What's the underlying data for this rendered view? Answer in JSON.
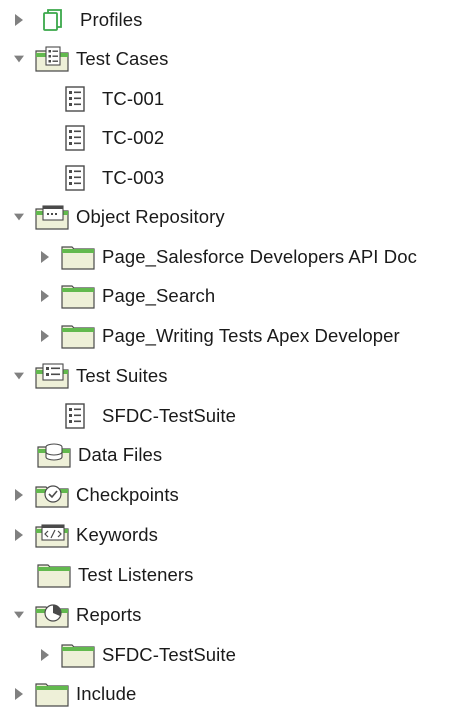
{
  "tree": {
    "items": [
      {
        "label": "Profiles",
        "expanded": false,
        "has_arrow": true,
        "icon": "profiles-icon"
      },
      {
        "label": "Test Cases",
        "expanded": true,
        "has_arrow": true,
        "icon": "test-cases-folder-icon"
      },
      {
        "label": "TC-001",
        "has_arrow": false,
        "icon": "test-case-icon"
      },
      {
        "label": "TC-002",
        "has_arrow": false,
        "icon": "test-case-icon"
      },
      {
        "label": "TC-003",
        "has_arrow": false,
        "icon": "test-case-icon"
      },
      {
        "label": "Object Repository",
        "expanded": true,
        "has_arrow": true,
        "icon": "object-repository-folder-icon"
      },
      {
        "label": "Page_Salesforce Developers  API Doc",
        "expanded": false,
        "has_arrow": true,
        "icon": "folder-icon"
      },
      {
        "label": "Page_Search",
        "expanded": false,
        "has_arrow": true,
        "icon": "folder-icon"
      },
      {
        "label": "Page_Writing Tests  Apex Developer",
        "expanded": false,
        "has_arrow": true,
        "icon": "folder-icon"
      },
      {
        "label": "Test Suites",
        "expanded": true,
        "has_arrow": true,
        "icon": "test-suites-folder-icon"
      },
      {
        "label": "SFDC-TestSuite",
        "has_arrow": false,
        "icon": "test-suite-icon"
      },
      {
        "label": "Data Files",
        "has_arrow": false,
        "icon": "data-files-folder-icon"
      },
      {
        "label": "Checkpoints",
        "expanded": false,
        "has_arrow": true,
        "icon": "checkpoints-folder-icon"
      },
      {
        "label": "Keywords",
        "expanded": false,
        "has_arrow": true,
        "icon": "keywords-folder-icon"
      },
      {
        "label": "Test Listeners",
        "has_arrow": false,
        "icon": "test-listeners-folder-icon"
      },
      {
        "label": "Reports",
        "expanded": true,
        "has_arrow": true,
        "icon": "reports-folder-icon"
      },
      {
        "label": "SFDC-TestSuite",
        "expanded": false,
        "has_arrow": true,
        "icon": "folder-icon"
      },
      {
        "label": "Include",
        "expanded": false,
        "has_arrow": true,
        "icon": "include-folder-icon"
      }
    ]
  },
  "colors": {
    "folder_fill": "#eef0d8",
    "folder_top": "#62b94e",
    "outline": "#4a4a4a",
    "arrow": "#808080",
    "text": "#1a1a1a"
  }
}
